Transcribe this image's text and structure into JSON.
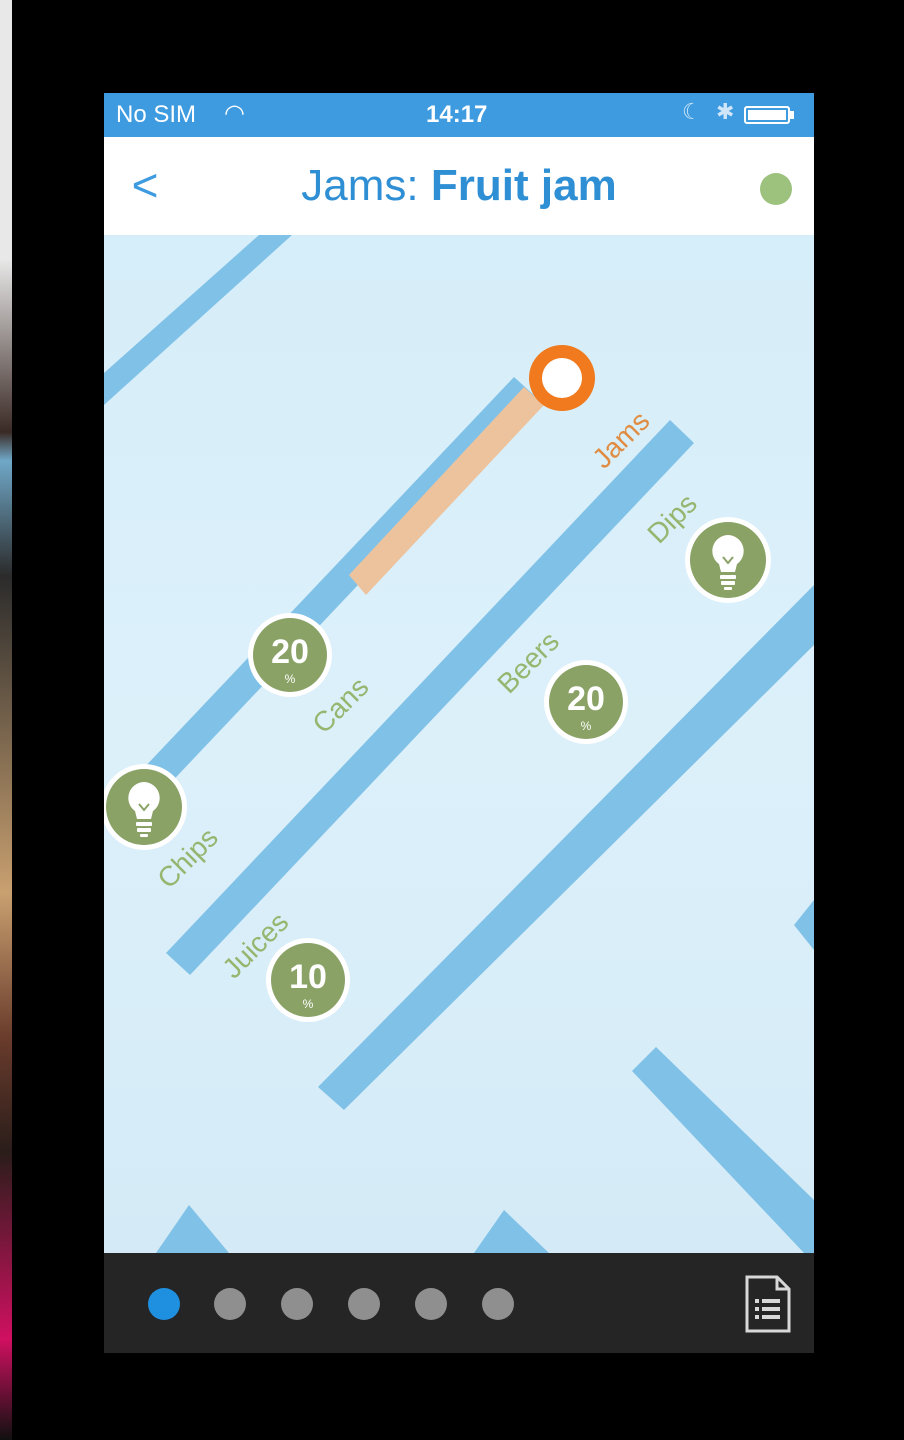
{
  "status_bar": {
    "carrier": "No SIM",
    "time": "14:17",
    "wifi_icon": "wifi-icon",
    "moon_icon": "moon-icon",
    "bluetooth_icon": "bluetooth-icon",
    "battery_icon": "battery-icon"
  },
  "nav": {
    "back_glyph": "<",
    "title_prefix": "Jams:",
    "title_product": "Fruit jam",
    "status_color": "#9cc27e"
  },
  "map": {
    "aisles": {
      "jams": "Jams",
      "dips": "Dips",
      "beers": "Beers",
      "cans": "Cans",
      "chips": "Chips",
      "juices": "Juices"
    },
    "markers": {
      "cans_discount": "20",
      "beers_discount": "20",
      "juices_discount": "10",
      "percent_sign": "%"
    },
    "colors": {
      "shelf": "#80c1e7",
      "route": "#edc39e",
      "destination": "#f07a1d",
      "marker": "#8aa266",
      "label_green": "#96b56e",
      "label_orange": "#e08c42"
    }
  },
  "pager": {
    "page_count": 6,
    "active_page": 1,
    "list_icon": "shopping-list-icon"
  }
}
